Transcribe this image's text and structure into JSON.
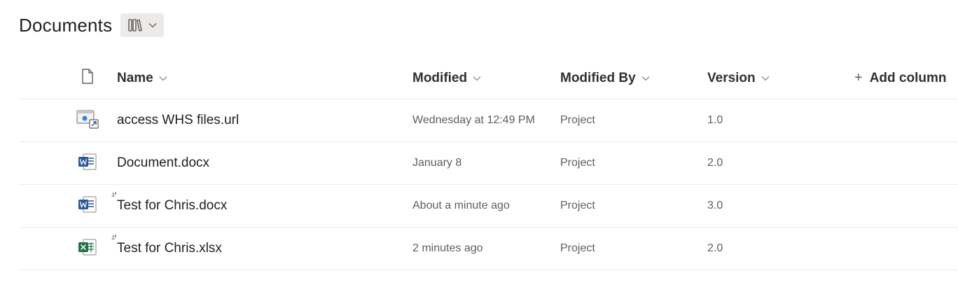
{
  "library": {
    "title": "Documents",
    "view_switcher_icon": "library-icon"
  },
  "columns": {
    "file_type_icon": "document-icon",
    "name": "Name",
    "modified": "Modified",
    "modified_by": "Modified By",
    "version": "Version",
    "add_column": "Add column"
  },
  "rows": [
    {
      "icon": "link-file-icon",
      "name": "access WHS files.url",
      "modified": "Wednesday at 12:49 PM",
      "modified_by": "Project",
      "version": "1.0",
      "new": false
    },
    {
      "icon": "word-icon",
      "name": "Document.docx",
      "modified": "January 8",
      "modified_by": "Project",
      "version": "2.0",
      "new": false
    },
    {
      "icon": "word-icon",
      "name": "Test for Chris.docx",
      "modified": "About a minute ago",
      "modified_by": "Project",
      "version": "3.0",
      "new": true
    },
    {
      "icon": "excel-icon",
      "name": "Test for Chris.xlsx",
      "modified": "2 minutes ago",
      "modified_by": "Project",
      "version": "2.0",
      "new": true
    }
  ],
  "colors": {
    "word": "#2b579a",
    "excel": "#217346",
    "divider": "#edebe9",
    "switcher_bg": "#edebe9"
  }
}
